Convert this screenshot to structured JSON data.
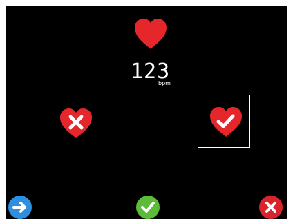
{
  "reading": {
    "value": "123",
    "unit": "bpm"
  },
  "icons": {
    "heart": "heart-icon",
    "reject_choice": "heart-with-x-icon",
    "accept_choice": "heart-with-check-icon",
    "next": "arrow-right-icon",
    "confirm": "check-icon",
    "cancel": "close-icon"
  },
  "colors": {
    "background": "#000000",
    "heart": "#e5262b",
    "next_button": "#2e8fe0",
    "confirm_button": "#5dbb3a",
    "cancel_button": "#d9232d",
    "selection_border": "#ffffff"
  },
  "selection": {
    "selected_choice": "accept"
  }
}
